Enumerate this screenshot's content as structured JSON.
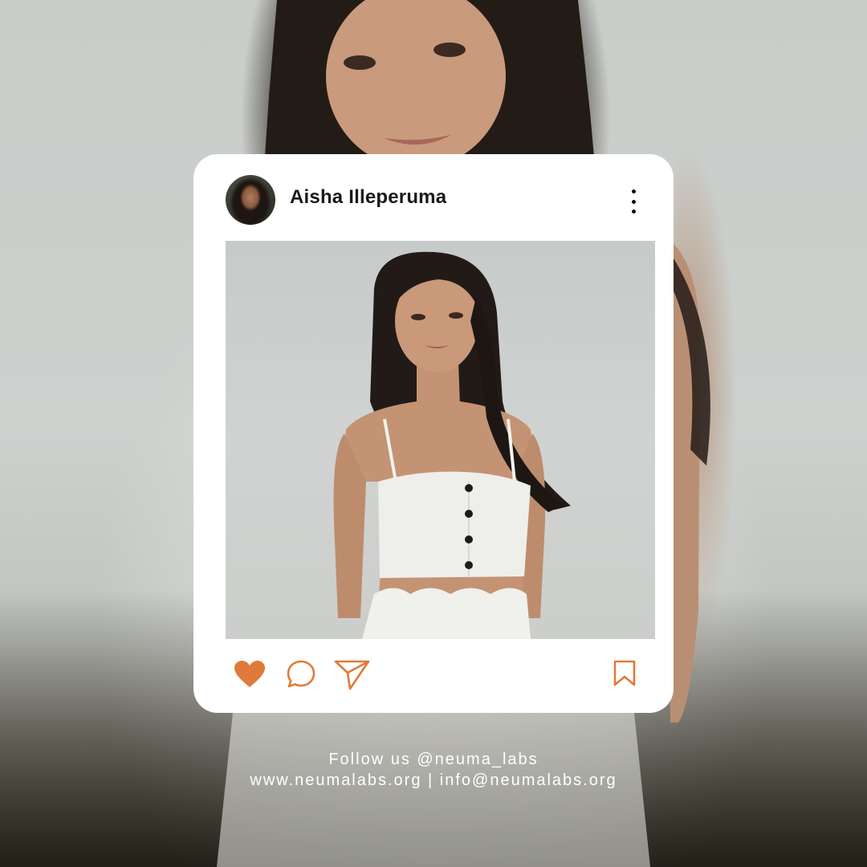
{
  "post": {
    "username": "Aisha Illeperuma"
  },
  "icons": {
    "avatar": "profile-avatar",
    "more": "more-vertical-icon",
    "like": "heart-icon",
    "comment": "comment-icon",
    "share": "send-icon",
    "save": "bookmark-icon"
  },
  "colors": {
    "accent": "#e07a3a",
    "card": "#ffffff",
    "text": "#1a1a1a"
  },
  "footer": {
    "follow": "Follow us @neuma_labs",
    "contact": "www.neumalabs.org | info@neumalabs.org"
  }
}
